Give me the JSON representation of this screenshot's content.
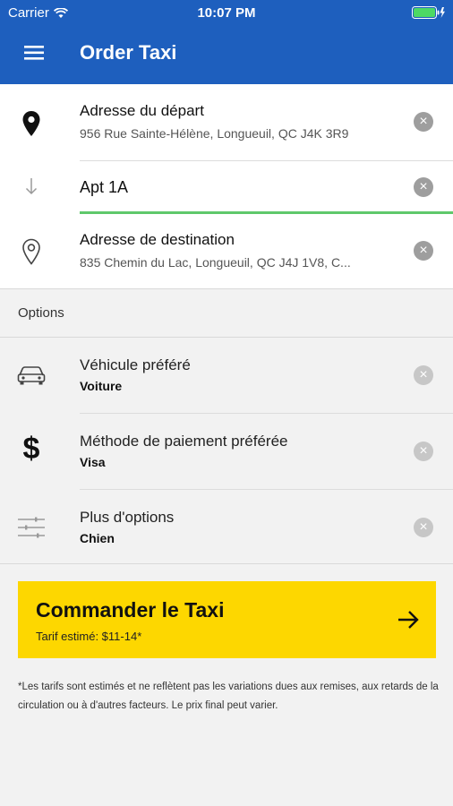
{
  "status_bar": {
    "carrier": "Carrier",
    "time": "10:07 PM"
  },
  "app_bar": {
    "title": "Order Taxi",
    "menu_icon": "hamburger-menu-icon"
  },
  "addresses": {
    "departure": {
      "label": "Adresse du départ",
      "value": "956 Rue Sainte-Hélène, Longueuil, QC J4K 3R9"
    },
    "apartment": {
      "value": "Apt 1A"
    },
    "destination": {
      "label": "Adresse de destination",
      "value": "835 Chemin du Lac, Longueuil, QC J4J 1V8, C..."
    }
  },
  "options": {
    "section_label": "Options",
    "vehicle": {
      "label": "Véhicule préféré",
      "value": "Voiture"
    },
    "payment": {
      "label": "Méthode de paiement préférée",
      "value": "Visa",
      "symbol": "$"
    },
    "more": {
      "label": "Plus d'options",
      "value": "Chien"
    }
  },
  "order_button": {
    "title": "Commander le Taxi",
    "fare": "Tarif estimé: $11-14*"
  },
  "disclaimer": "*Les tarifs sont estimés et ne reflètent pas les variations dues aux remises, aux retards de la circulation ou à d'autres facteurs. Le prix final peut varier.",
  "colors": {
    "primary": "#1e5fbe",
    "accent": "#fdd700",
    "focus_line": "#5fc86b",
    "clear_icon": "#9e9e9e"
  }
}
